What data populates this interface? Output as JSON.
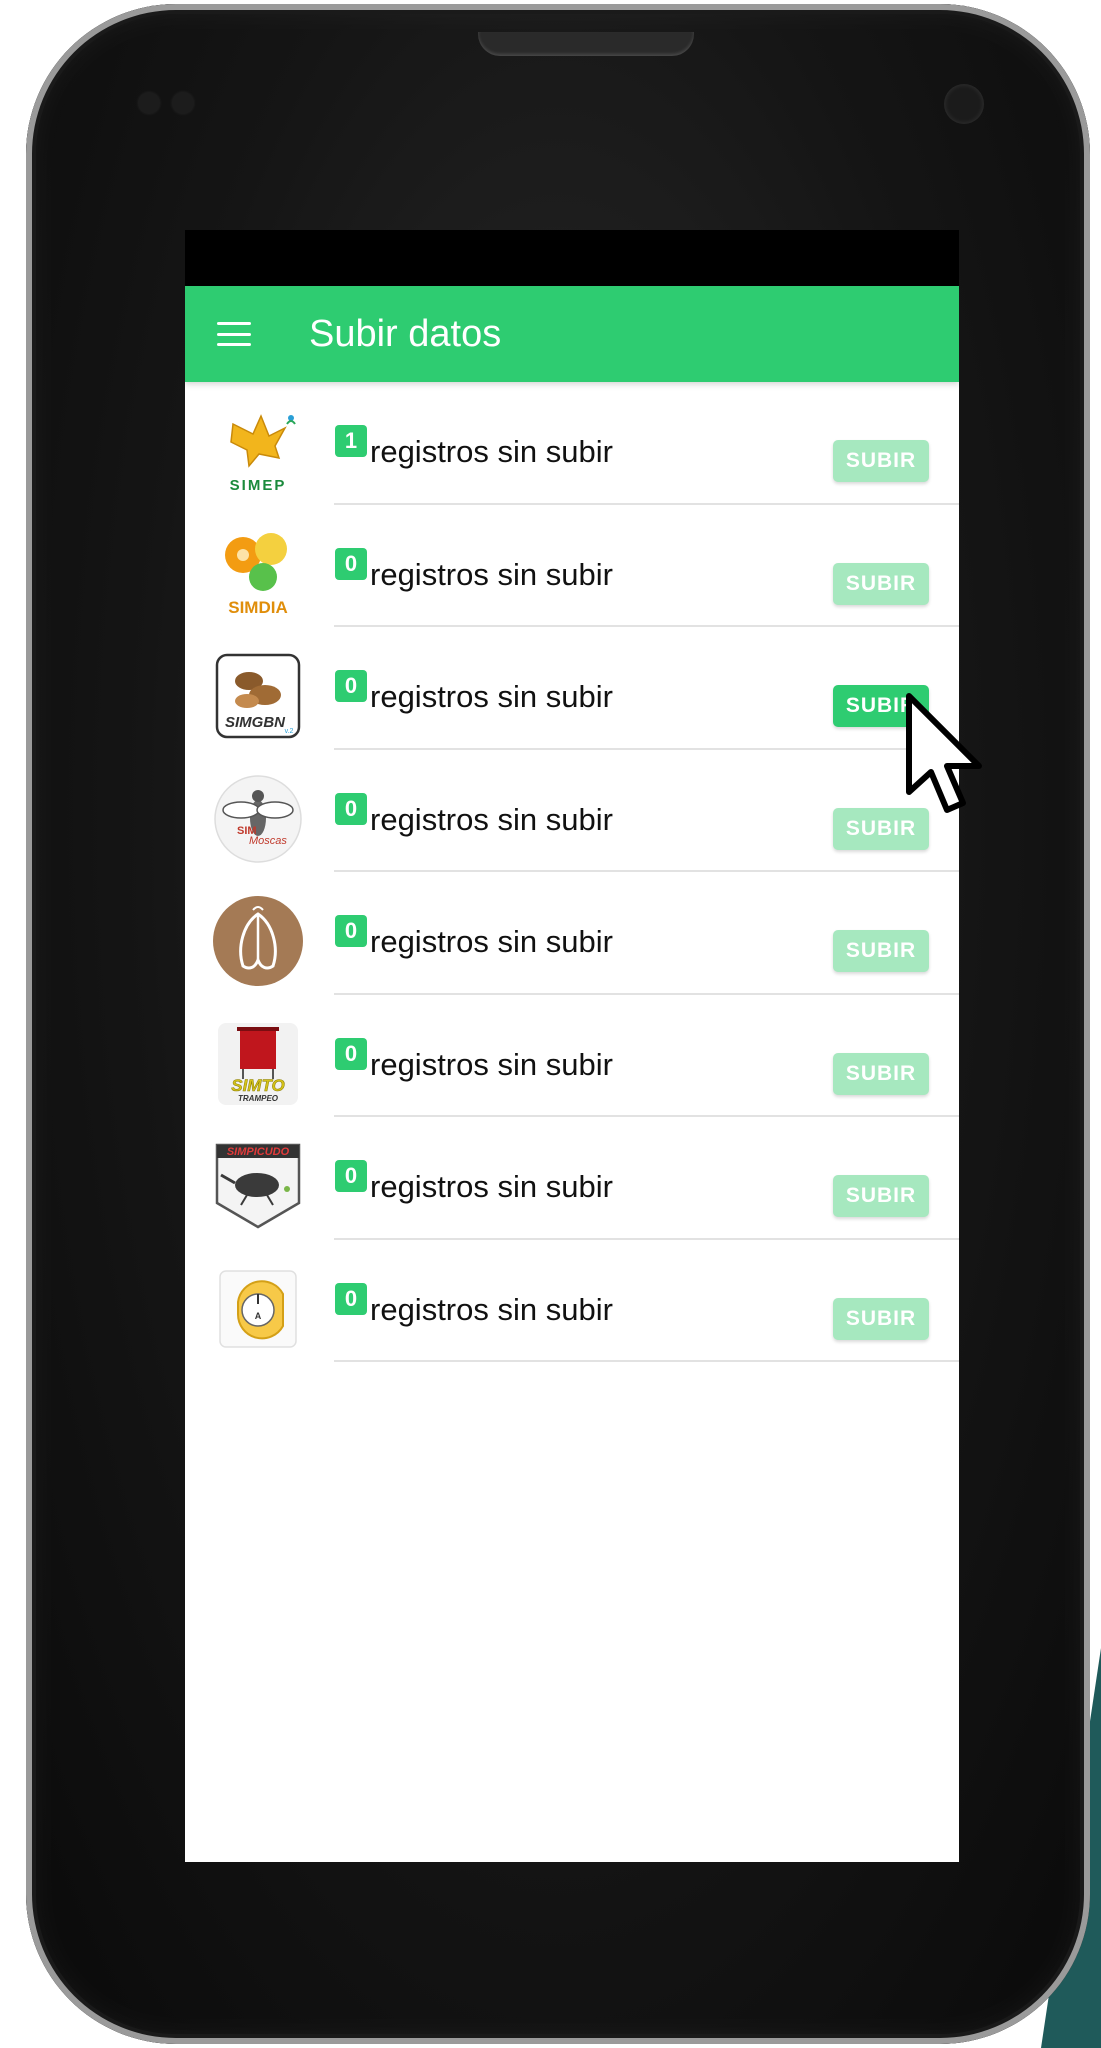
{
  "app_bar": {
    "title": "Subir datos",
    "menu_icon": "hamburger-menu-icon"
  },
  "colors": {
    "primary": "#2ecc71",
    "button_disabled": "#a6e8bf"
  },
  "rows": [
    {
      "app": "SIMEP",
      "logo_icon": "simep-logo-icon",
      "count": "1",
      "text": "registros sin subir",
      "button": "SUBIR",
      "active": false
    },
    {
      "app": "SIMDIA",
      "logo_icon": "simdia-logo-icon",
      "count": "0",
      "text": "registros sin subir",
      "button": "SUBIR",
      "active": false
    },
    {
      "app": "SIMGBN",
      "logo_icon": "simgbn-logo-icon",
      "count": "0",
      "text": "registros sin subir",
      "button": "SUBIR",
      "active": true
    },
    {
      "app": "SIM Moscas",
      "logo_icon": "sim-moscas-logo-icon",
      "count": "0",
      "text": "registros sin subir",
      "button": "SUBIR",
      "active": false
    },
    {
      "app": "moth",
      "logo_icon": "moth-logo-icon",
      "count": "0",
      "text": "registros sin subir",
      "button": "SUBIR",
      "active": false
    },
    {
      "app": "SIMTO TRAMPEO",
      "logo_icon": "simto-trampeo-logo-icon",
      "count": "0",
      "text": "registros sin subir",
      "button": "SUBIR",
      "active": false
    },
    {
      "app": "SIMPICUDO",
      "logo_icon": "simpicudo-logo-icon",
      "count": "0",
      "text": "registros sin subir",
      "button": "SUBIR",
      "active": false
    },
    {
      "app": "trap",
      "logo_icon": "trap-logo-icon",
      "count": "0",
      "text": "registros sin subir",
      "button": "SUBIR",
      "active": false
    }
  ],
  "logo_text": {
    "simep": "SIMEP",
    "simdia": "SIMDIA",
    "simgbn": "SIMGBN",
    "simgbn_version": "v.2",
    "moscas_sim": "SIM",
    "moscas": "Moscas",
    "simto": "SIMTO",
    "trampeo": "TRAMPEO",
    "simpicudo": "SIMPICUDO",
    "trap_letter": "A"
  }
}
